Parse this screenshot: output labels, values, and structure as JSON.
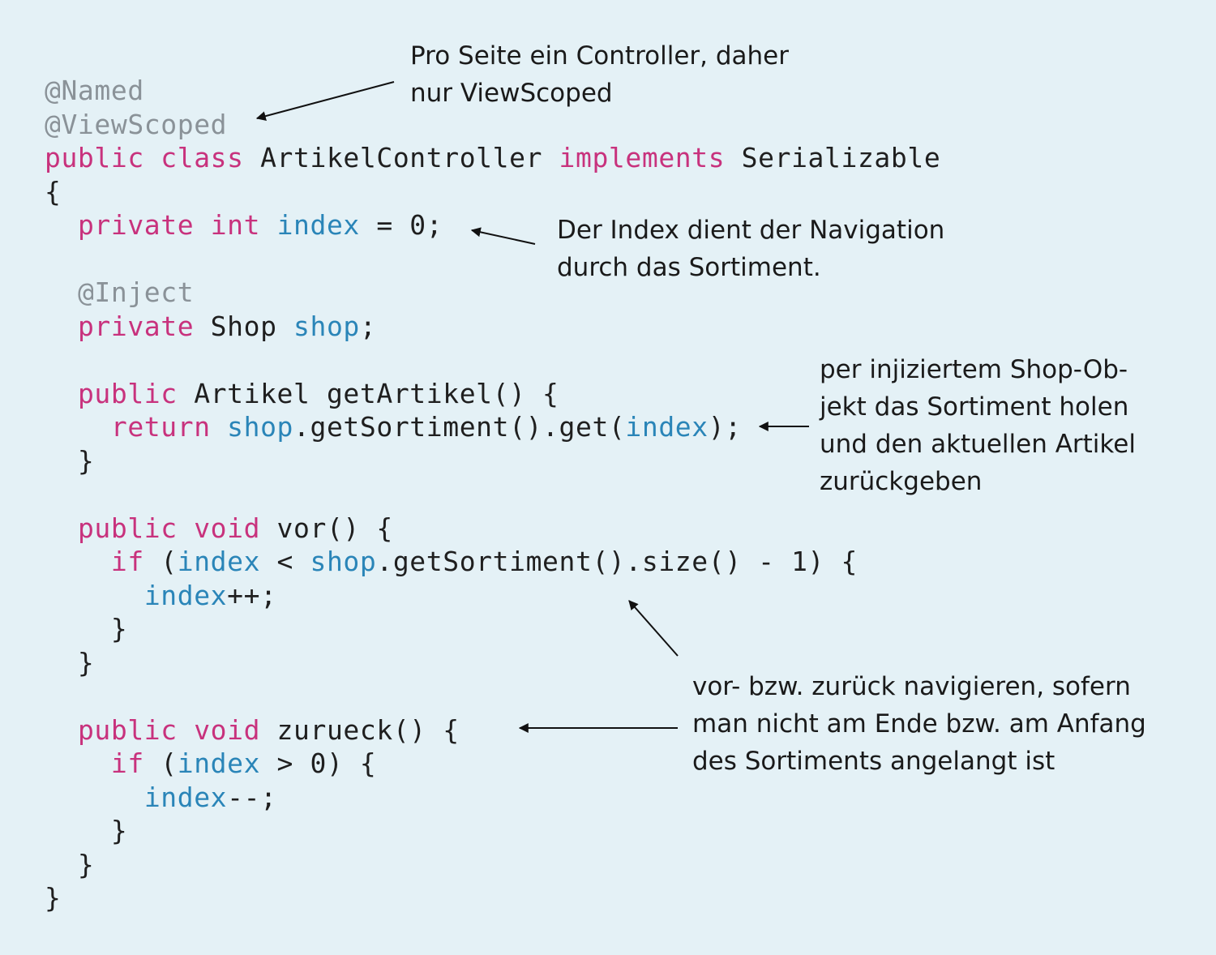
{
  "code": {
    "lines": [
      [
        {
          "t": "@Named",
          "c": "annotation"
        }
      ],
      [
        {
          "t": "@ViewScoped",
          "c": "annotation"
        }
      ],
      [
        {
          "t": "public",
          "c": "keyword"
        },
        {
          "t": " ",
          "c": "plain"
        },
        {
          "t": "class",
          "c": "keyword"
        },
        {
          "t": " ArtikelController ",
          "c": "plain"
        },
        {
          "t": "implements",
          "c": "keyword"
        },
        {
          "t": " Serializable",
          "c": "plain"
        }
      ],
      [
        {
          "t": "{",
          "c": "plain"
        }
      ],
      [
        {
          "t": "  ",
          "c": "plain"
        },
        {
          "t": "private",
          "c": "keyword"
        },
        {
          "t": " ",
          "c": "plain"
        },
        {
          "t": "int",
          "c": "keyword"
        },
        {
          "t": " ",
          "c": "plain"
        },
        {
          "t": "index",
          "c": "ident"
        },
        {
          "t": " = 0;",
          "c": "plain"
        }
      ],
      [],
      [
        {
          "t": "  ",
          "c": "plain"
        },
        {
          "t": "@Inject",
          "c": "annotation"
        }
      ],
      [
        {
          "t": "  ",
          "c": "plain"
        },
        {
          "t": "private",
          "c": "keyword"
        },
        {
          "t": " Shop ",
          "c": "plain"
        },
        {
          "t": "shop",
          "c": "ident"
        },
        {
          "t": ";",
          "c": "plain"
        }
      ],
      [],
      [
        {
          "t": "  ",
          "c": "plain"
        },
        {
          "t": "public",
          "c": "keyword"
        },
        {
          "t": " Artikel getArtikel() {",
          "c": "plain"
        }
      ],
      [
        {
          "t": "    ",
          "c": "plain"
        },
        {
          "t": "return",
          "c": "keyword"
        },
        {
          "t": " ",
          "c": "plain"
        },
        {
          "t": "shop",
          "c": "ident"
        },
        {
          "t": ".getSortiment().get(",
          "c": "plain"
        },
        {
          "t": "index",
          "c": "ident"
        },
        {
          "t": ");",
          "c": "plain"
        }
      ],
      [
        {
          "t": "  }",
          "c": "plain"
        }
      ],
      [],
      [
        {
          "t": "  ",
          "c": "plain"
        },
        {
          "t": "public",
          "c": "keyword"
        },
        {
          "t": " ",
          "c": "plain"
        },
        {
          "t": "void",
          "c": "keyword"
        },
        {
          "t": " vor() {",
          "c": "plain"
        }
      ],
      [
        {
          "t": "    ",
          "c": "plain"
        },
        {
          "t": "if",
          "c": "keyword"
        },
        {
          "t": " (",
          "c": "plain"
        },
        {
          "t": "index",
          "c": "ident"
        },
        {
          "t": " < ",
          "c": "plain"
        },
        {
          "t": "shop",
          "c": "ident"
        },
        {
          "t": ".getSortiment().size() - 1) {",
          "c": "plain"
        }
      ],
      [
        {
          "t": "      ",
          "c": "plain"
        },
        {
          "t": "index",
          "c": "ident"
        },
        {
          "t": "++;",
          "c": "plain"
        }
      ],
      [
        {
          "t": "    }",
          "c": "plain"
        }
      ],
      [
        {
          "t": "  }",
          "c": "plain"
        }
      ],
      [],
      [
        {
          "t": "  ",
          "c": "plain"
        },
        {
          "t": "public",
          "c": "keyword"
        },
        {
          "t": " ",
          "c": "plain"
        },
        {
          "t": "void",
          "c": "keyword"
        },
        {
          "t": " zurueck() {",
          "c": "plain"
        }
      ],
      [
        {
          "t": "    ",
          "c": "plain"
        },
        {
          "t": "if",
          "c": "keyword"
        },
        {
          "t": " (",
          "c": "plain"
        },
        {
          "t": "index",
          "c": "ident"
        },
        {
          "t": " > 0) {",
          "c": "plain"
        }
      ],
      [
        {
          "t": "      ",
          "c": "plain"
        },
        {
          "t": "index",
          "c": "ident"
        },
        {
          "t": "--;",
          "c": "plain"
        }
      ],
      [
        {
          "t": "    }",
          "c": "plain"
        }
      ],
      [
        {
          "t": "  }",
          "c": "plain"
        }
      ],
      [
        {
          "t": "}",
          "c": "plain"
        }
      ]
    ]
  },
  "annotations": {
    "viewscoped_note": [
      "Pro Seite ein Controller, daher",
      "nur ViewScoped"
    ],
    "index_note": [
      "Der Index dient der Navigation",
      "durch das Sortiment."
    ],
    "getartikel_note": [
      "per injiziertem Shop-Ob-",
      "jekt das Sortiment holen",
      "und den aktuellen Artikel",
      "zurückgeben"
    ],
    "navigation_note": [
      "vor- bzw. zurück navigieren, sofern",
      "man nicht am Ende bzw. am Anfang",
      "des Sortiments angelangt ist"
    ]
  },
  "colors": {
    "background": "#e4f1f6",
    "keyword": "#c8327d",
    "annotation": "#8a9298",
    "identifier": "#2a85b8",
    "text": "#1f1f1f"
  }
}
